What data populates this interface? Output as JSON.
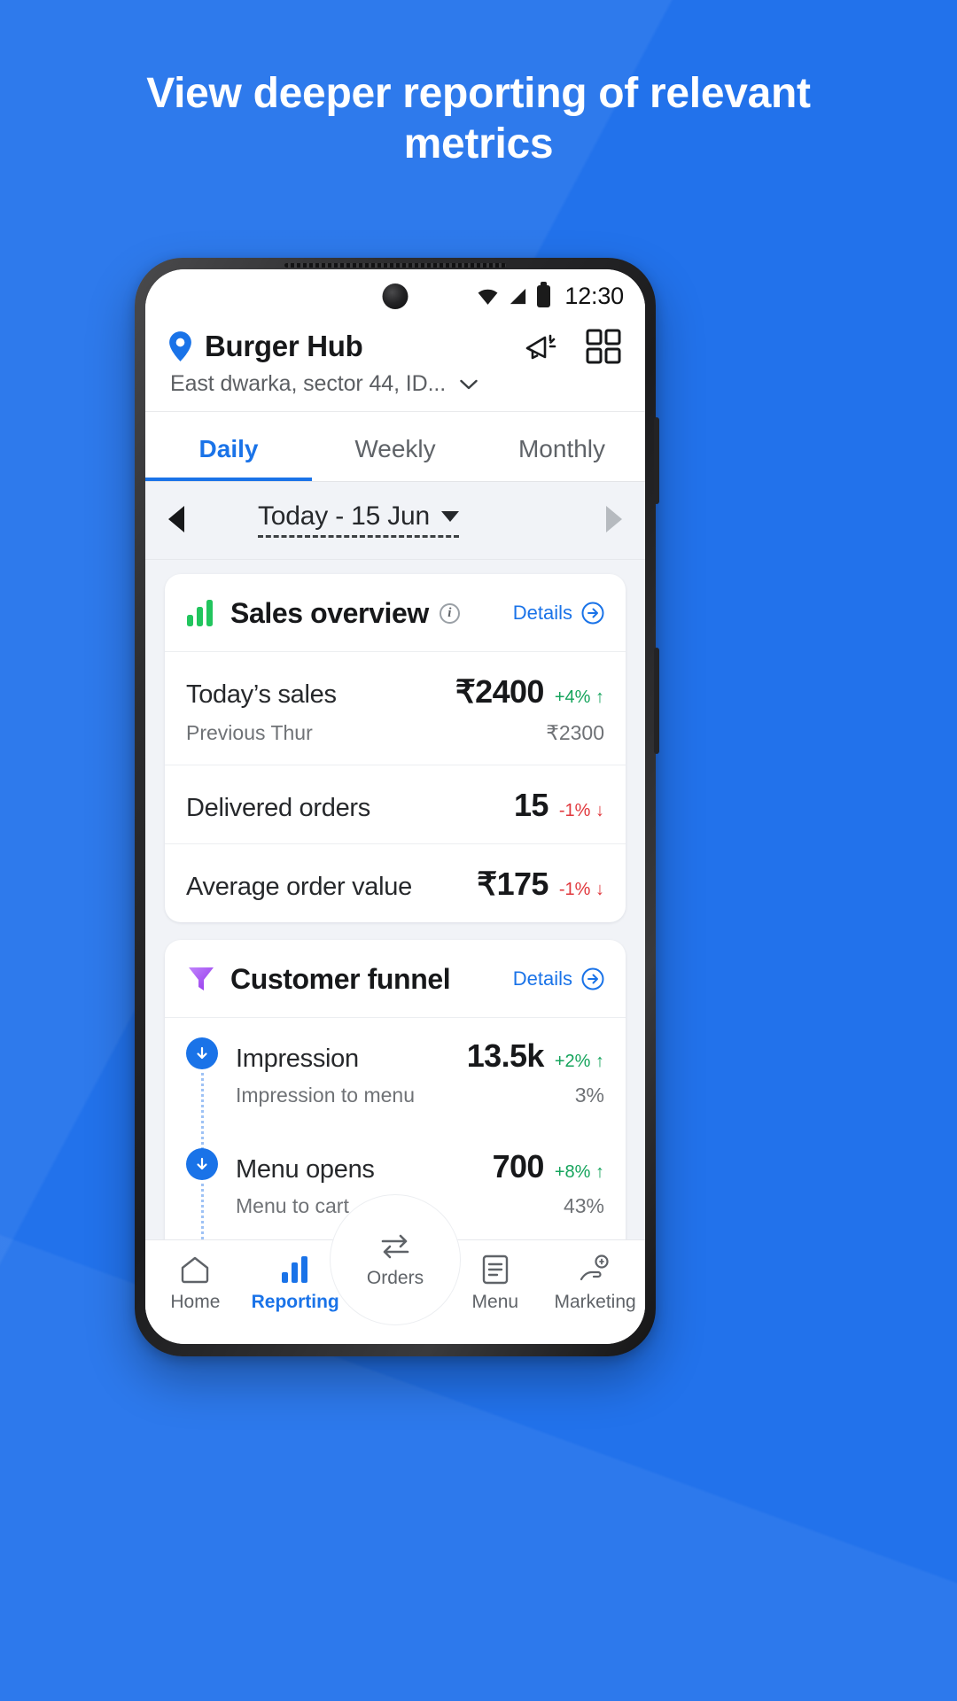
{
  "headline": "View deeper reporting of relevant metrics",
  "colors": {
    "background": "#2272EB",
    "accent": "#1a73e8",
    "positive": "#15a45c",
    "negative": "#e0373c",
    "sales_icon": "#22c55e",
    "funnel_icon": "#a855f7"
  },
  "status_bar": {
    "time": "12:30",
    "wifi_icon": "wifi-icon",
    "signal_icon": "signal-icon",
    "battery_icon": "battery-icon"
  },
  "header": {
    "pin_icon": "location-pin-icon",
    "store_name": "Burger Hub",
    "address": "East dwarka, sector 44, ID...",
    "chevron_icon": "chevron-down-icon",
    "megaphone_icon": "megaphone-icon",
    "qr_icon": "qr-grid-icon"
  },
  "tabs": [
    {
      "label": "Daily",
      "active": true
    },
    {
      "label": "Weekly",
      "active": false
    },
    {
      "label": "Monthly",
      "active": false
    }
  ],
  "date_nav": {
    "prev_icon": "arrow-left-icon",
    "label": "Today - 15 Jun",
    "caret_icon": "caret-down-icon",
    "next_icon": "arrow-right-icon"
  },
  "sales_card": {
    "icon": "bar-chart-icon",
    "title": "Sales overview",
    "info_icon": "info-icon",
    "details_label": "Details",
    "details_icon": "arrow-circle-right-icon",
    "metrics": [
      {
        "label": "Today’s sales",
        "value": "₹2400",
        "delta": "+4%",
        "delta_dir": "up",
        "sub_label": "Previous Thur",
        "sub_value": "₹2300"
      },
      {
        "label": "Delivered orders",
        "value": "15",
        "delta": "-1%",
        "delta_dir": "down",
        "sub_label": "",
        "sub_value": ""
      },
      {
        "label": "Average order value",
        "value": "₹175",
        "delta": "-1%",
        "delta_dir": "down",
        "sub_label": "",
        "sub_value": ""
      }
    ]
  },
  "funnel_card": {
    "icon": "funnel-icon",
    "title": "Customer funnel",
    "details_label": "Details",
    "details_icon": "arrow-circle-right-icon",
    "steps": [
      {
        "name": "Impression",
        "value": "13.5k",
        "delta": "+2%",
        "delta_dir": "up",
        "sub_label": "Impression to menu",
        "sub_value": "3%"
      },
      {
        "name": "Menu opens",
        "value": "700",
        "delta": "+8%",
        "delta_dir": "up",
        "sub_label": "Menu to cart",
        "sub_value": "43%"
      }
    ]
  },
  "bottom_nav": [
    {
      "label": "Home",
      "icon": "home-icon",
      "active": false
    },
    {
      "label": "Reporting",
      "icon": "bar-chart-icon",
      "active": true
    },
    {
      "label": "Orders",
      "icon": "orders-swap-icon",
      "active": false
    },
    {
      "label": "Menu",
      "icon": "menu-list-icon",
      "active": false
    },
    {
      "label": "Marketing",
      "icon": "marketing-hand-icon",
      "active": false
    }
  ]
}
